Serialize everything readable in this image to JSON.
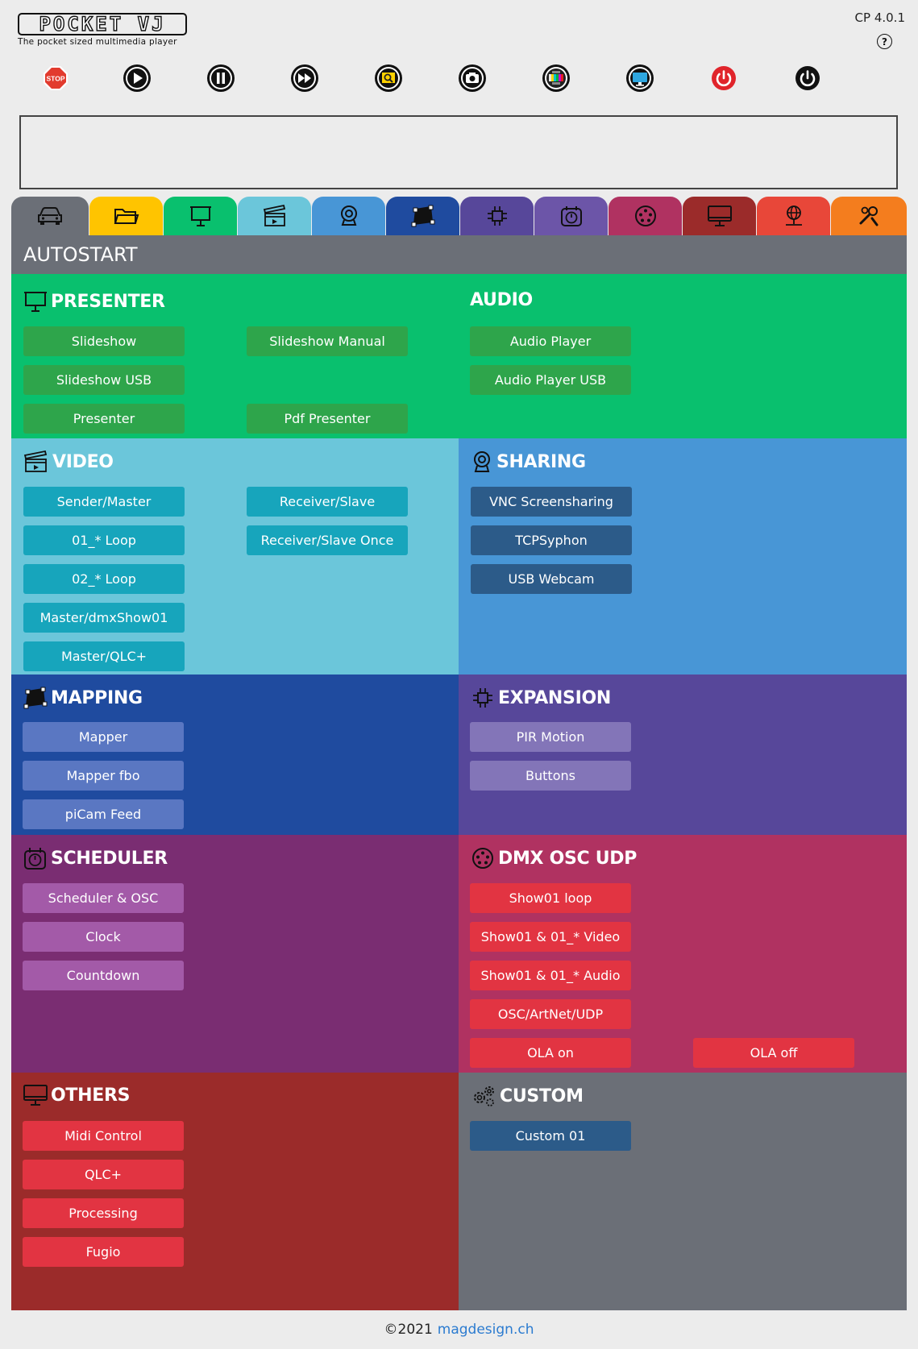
{
  "app": {
    "logo_text": "POCKET VJ",
    "tagline": "The pocket sized multimedia player",
    "version": "CP 4.0.1",
    "help": "?"
  },
  "toolbar": {
    "stop_label": "STOP",
    "buttons": [
      "stop-icon",
      "play-icon",
      "pause-icon",
      "fast-forward-icon",
      "preview-icon",
      "camera-icon",
      "test-pattern-icon",
      "screen-icon",
      "power-off-icon",
      "shutdown-icon"
    ]
  },
  "tabs": [
    {
      "icon": "car-icon",
      "color": "#6b6f77"
    },
    {
      "icon": "folder-icon",
      "color": "#ffc400"
    },
    {
      "icon": "presenter-icon",
      "color": "#09c06e"
    },
    {
      "icon": "video-clapper-icon",
      "color": "#6bc6da"
    },
    {
      "icon": "webcam-icon",
      "color": "#4896d6"
    },
    {
      "icon": "mapping-icon",
      "color": "#1f4b9f"
    },
    {
      "icon": "chip-icon",
      "color": "#57479a"
    },
    {
      "icon": "scheduler-clock-icon",
      "color": "#6c55a8"
    },
    {
      "icon": "dmx-icon",
      "color": "#b03261"
    },
    {
      "icon": "monitor-icon",
      "color": "#9b2b2a"
    },
    {
      "icon": "network-globe-icon",
      "color": "#e84739"
    },
    {
      "icon": "tools-icon",
      "color": "#f47d1e"
    }
  ],
  "page_title": "AUTOSTART",
  "sections": {
    "presenter": {
      "title": "PRESENTER",
      "buttons": [
        "Slideshow",
        "Slideshow Manual",
        "Slideshow USB",
        "Presenter",
        "Pdf Presenter"
      ]
    },
    "audio": {
      "title": "AUDIO",
      "buttons": [
        "Audio Player",
        "Audio Player USB"
      ]
    },
    "video": {
      "title": "VIDEO",
      "buttons": [
        "Sender/Master",
        "Receiver/Slave",
        "01_* Loop",
        "Receiver/Slave Once",
        "02_* Loop",
        "Master/dmxShow01",
        "Master/QLC+"
      ]
    },
    "sharing": {
      "title": "SHARING",
      "buttons": [
        "VNC Screensharing",
        "TCPSyphon",
        "USB Webcam"
      ]
    },
    "mapping": {
      "title": "MAPPING",
      "buttons": [
        "Mapper",
        "Mapper fbo",
        "piCam Feed"
      ]
    },
    "expansion": {
      "title": "EXPANSION",
      "buttons": [
        "PIR Motion",
        "Buttons"
      ]
    },
    "scheduler": {
      "title": "SCHEDULER",
      "buttons": [
        "Scheduler & OSC",
        "Clock",
        "Countdown"
      ]
    },
    "dmx": {
      "title": "DMX OSC UDP",
      "buttons": [
        "Show01 loop",
        "Show01 & 01_* Video",
        "Show01 & 01_* Audio",
        "OSC/ArtNet/UDP",
        "OLA on",
        "OLA off"
      ]
    },
    "others": {
      "title": "OTHERS",
      "buttons": [
        "Midi Control",
        "QLC+",
        "Processing",
        "Fugio"
      ]
    },
    "custom": {
      "title": "CUSTOM",
      "buttons": [
        "Custom 01"
      ]
    }
  },
  "footer": {
    "copyright": "©2021",
    "link": "magdesign.ch"
  }
}
